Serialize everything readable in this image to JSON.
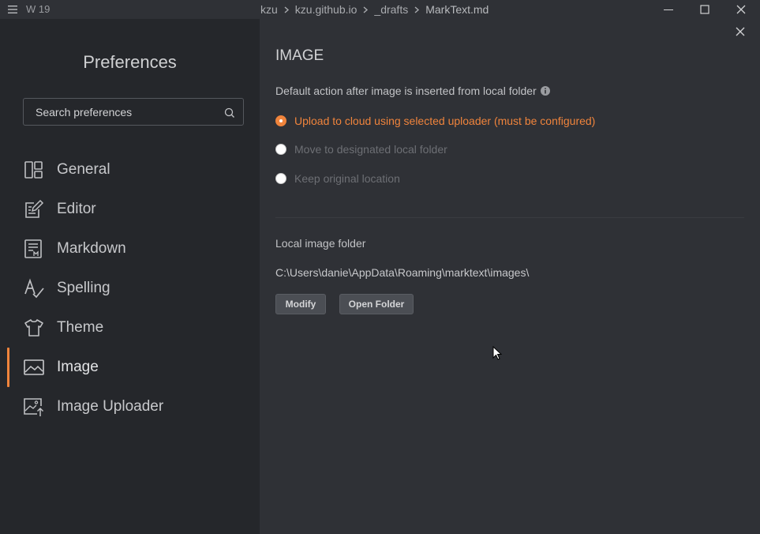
{
  "titlebar": {
    "word_count": "W 19",
    "breadcrumbs": [
      "kzu",
      "kzu.github.io",
      "_drafts"
    ],
    "file_name": "MarkText.md"
  },
  "sidebar": {
    "title": "Preferences",
    "search_placeholder": "Search preferences",
    "items": [
      {
        "label": "General",
        "icon": "general-icon"
      },
      {
        "label": "Editor",
        "icon": "editor-icon"
      },
      {
        "label": "Markdown",
        "icon": "markdown-icon"
      },
      {
        "label": "Spelling",
        "icon": "spelling-icon"
      },
      {
        "label": "Theme",
        "icon": "theme-icon"
      },
      {
        "label": "Image",
        "icon": "image-icon",
        "active": true
      },
      {
        "label": "Image Uploader",
        "icon": "image-uploader-icon"
      }
    ]
  },
  "main": {
    "section_title": "IMAGE",
    "insert_action": {
      "label": "Default action after image is inserted from local folder",
      "options": [
        {
          "label": "Upload to cloud using selected uploader (must be configured)",
          "checked": true
        },
        {
          "label": "Move to designated local folder",
          "checked": false
        },
        {
          "label": "Keep original location",
          "checked": false
        }
      ]
    },
    "local_folder": {
      "label": "Local image folder",
      "path": "C:\\Users\\danie\\AppData\\Roaming\\marktext\\images\\",
      "modify_label": "Modify",
      "open_label": "Open Folder"
    }
  },
  "colors": {
    "accent": "#f0843c",
    "sidebar_bg": "#25272b",
    "main_bg": "#2f3136"
  }
}
